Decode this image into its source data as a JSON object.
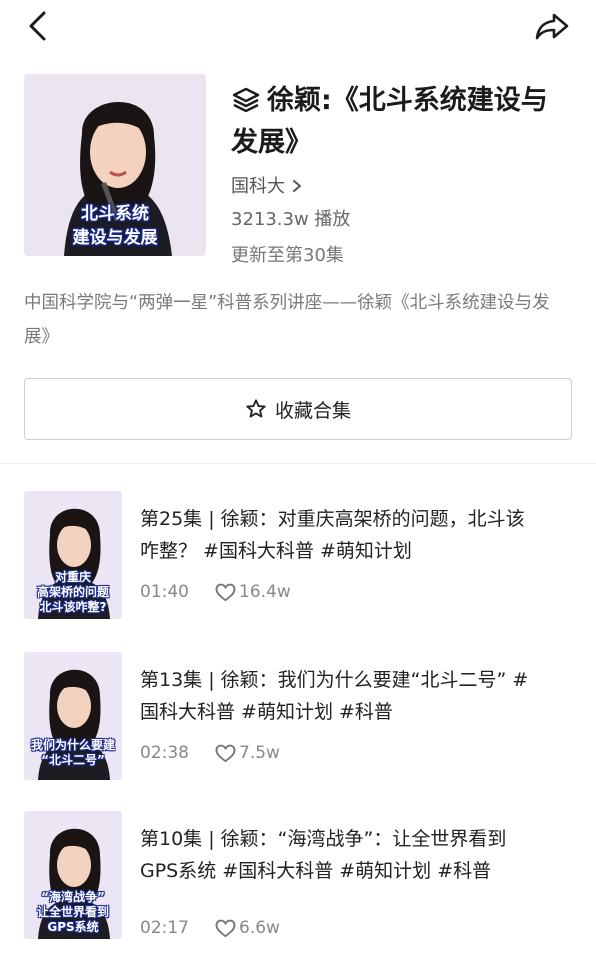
{
  "nav": {
    "back_icon": "chevron-left-icon",
    "share_icon": "share-arrow-icon"
  },
  "collection": {
    "cover_caption_line1": "北斗系统",
    "cover_caption_line2": "建设与发展",
    "title": "徐颖:《北斗系统建设与发展》",
    "title_icon": "stack-layers-icon",
    "author": "国科大",
    "plays": "3213.3w 播放",
    "update": "更新至第30集",
    "description": "中国科学院与“两弹一星”科普系列讲座——徐颖《北斗系统建设与发展》",
    "favorite_label": "收藏合集"
  },
  "episodes": [
    {
      "title": "第25集 | 徐颖：对重庆高架桥的问题，北斗该咋整？ #国科大科普  #萌知计划",
      "thumb_caption_line1": "对重庆",
      "thumb_caption_line2": "高架桥的问题",
      "thumb_caption_line3": "北斗该咋整?",
      "duration": "01:40",
      "likes": "16.4w"
    },
    {
      "title": "第13集 | 徐颖：我们为什么要建“北斗二号” #国科大科普  #萌知计划  #科普",
      "thumb_caption_line1": "我们为什么要建",
      "thumb_caption_line2": "“北斗二号”",
      "thumb_caption_line3": "",
      "duration": "02:38",
      "likes": "7.5w"
    },
    {
      "title": "第10集 | 徐颖：“海湾战争”：让全世界看到GPS系统  #国科大科普  #萌知计划  #科普",
      "thumb_caption_line1": "“海湾战争”",
      "thumb_caption_line2": "让全世界看到",
      "thumb_caption_line3": "GPS系统",
      "duration": "02:17",
      "likes": "6.6w"
    }
  ],
  "colors": {
    "accent_caption_outline": "#1a2a8a",
    "text_primary": "#222222",
    "text_secondary": "#888888"
  }
}
